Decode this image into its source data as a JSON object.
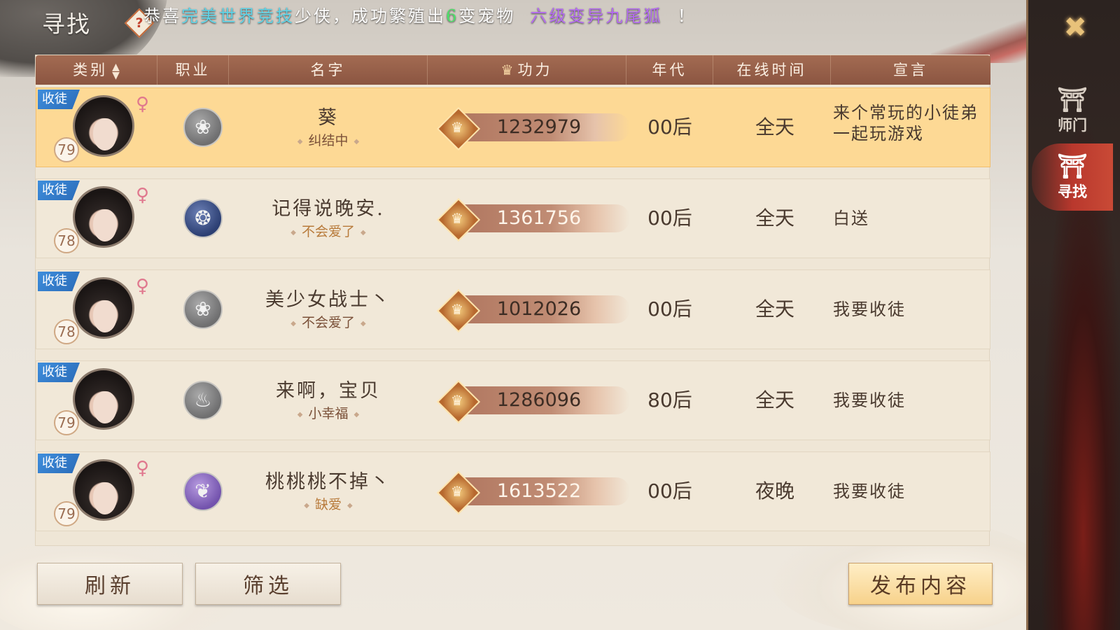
{
  "page_title": "寻找",
  "help_icon": "?",
  "announcement": {
    "prefix": "恭喜",
    "player": "完美世界竞技",
    "mid": "少侠，成功繁殖出",
    "number": "6",
    "pet_type": "变宠物",
    "pet_name": "六级变异九尾狐",
    "suffix": "！"
  },
  "sidebar": {
    "close_icon": "✕",
    "tabs": [
      {
        "label": "师门",
        "icon": "gate-icon",
        "selected": false
      },
      {
        "label": "寻找",
        "icon": "gate-icon",
        "selected": true
      }
    ]
  },
  "table": {
    "headers": {
      "category": "类别",
      "class": "职业",
      "name": "名字",
      "power": "功力",
      "era": "年代",
      "online": "在线时间",
      "declaration": "宣言"
    },
    "rows": [
      {
        "badge": "收徒",
        "level": "79",
        "gender": "♀",
        "class_icon": "lotus-icon",
        "name": "葵",
        "status": "纠结中",
        "power": "1232979",
        "era": "00后",
        "online": "全天",
        "declaration": "来个常玩的小徒弟一起玩游戏"
      },
      {
        "badge": "收徒",
        "level": "78",
        "gender": "♀",
        "class_icon": "swirl-icon",
        "name": "记得说晚安.",
        "status": "不会爱了",
        "power": "1361756",
        "era": "00后",
        "online": "全天",
        "declaration": "白送"
      },
      {
        "badge": "收徒",
        "level": "78",
        "gender": "♀",
        "class_icon": "lotus-icon",
        "name": "美少女战士丶",
        "status": "不会爱了",
        "power": "1012026",
        "era": "00后",
        "online": "全天",
        "declaration": "我要收徒"
      },
      {
        "badge": "收徒",
        "level": "79",
        "gender": "",
        "class_icon": "flame-icon",
        "name": "来啊，宝贝",
        "status": "小幸福",
        "power": "1286096",
        "era": "80后",
        "online": "全天",
        "declaration": "我要收徒"
      },
      {
        "badge": "收徒",
        "level": "79",
        "gender": "♀",
        "class_icon": "fan-icon",
        "name": "桃桃桃不掉丶",
        "status": "缺爱",
        "power": "1613522",
        "era": "00后",
        "online": "夜晚",
        "declaration": "我要收徒"
      }
    ]
  },
  "buttons": {
    "refresh": "刷新",
    "filter": "筛选",
    "publish": "发布内容"
  },
  "colors": {
    "header_bg": "#8b5541",
    "selected_row": "#fdd995",
    "badge_blue": "#2a6bb8",
    "announce_player": "#5fd3e6",
    "announce_number": "#4ee06a",
    "announce_pet": "#b46bf0"
  }
}
